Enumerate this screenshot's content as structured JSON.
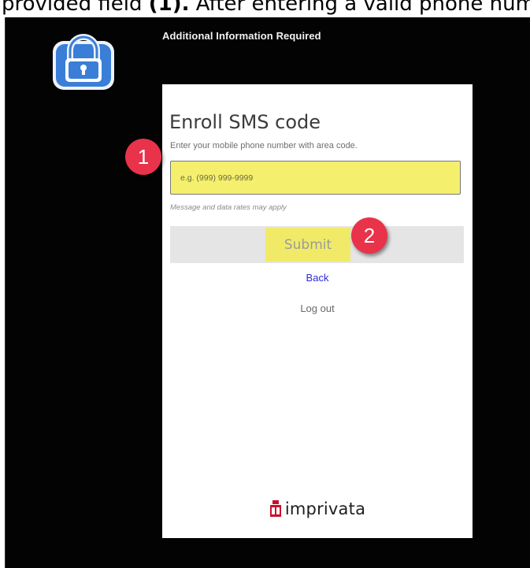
{
  "caption": {
    "before": "provided field ",
    "bold": "(1).",
    "after": " After entering a valid phone num"
  },
  "window": {
    "title": "Additional Information Required"
  },
  "card": {
    "title": "Enroll SMS code",
    "subtitle": "Enter your mobile phone number with area code.",
    "phone_placeholder": "e.g. (999) 999-9999",
    "phone_value": "",
    "rates_note": "Message and data rates may apply",
    "submit_label": "Submit",
    "back_label": "Back",
    "logout_label": "Log out",
    "brand_name": "imprivata"
  },
  "callouts": [
    "1",
    "2"
  ],
  "colors": {
    "window_bg": "#030303",
    "highlight": "#f1ea68",
    "callout": "#e8334a",
    "link": "#2b2be0",
    "brand": "#c8102e",
    "lock_blue": "#3a7ed8"
  },
  "icons": {
    "app": "lock-icon",
    "brand": "imprivata-logo-icon"
  }
}
